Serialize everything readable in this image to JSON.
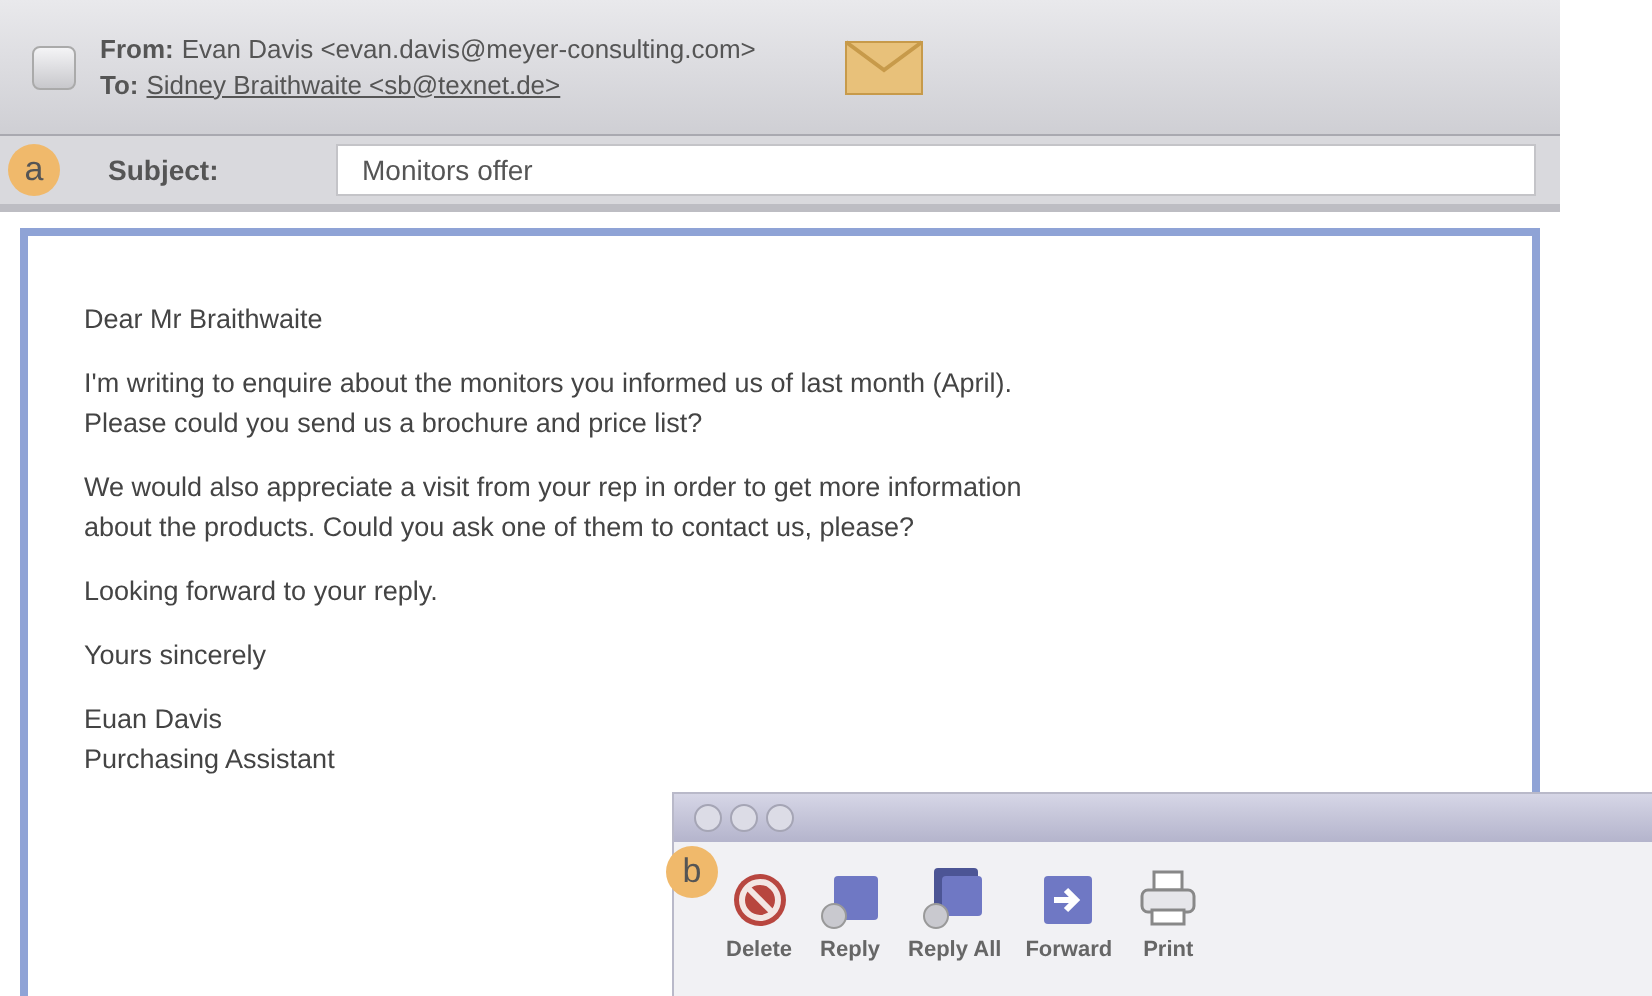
{
  "header": {
    "from_label": "From:",
    "from_value": "Evan Davis <evan.davis@meyer-consulting.com>",
    "to_label": "To:",
    "to_value": "Sidney Braithwaite <sb@texnet.de>"
  },
  "subject": {
    "callout": "a",
    "label": "Subject:",
    "value": "Monitors offer"
  },
  "body": [
    {
      "lines": [
        "Dear Mr Braithwaite"
      ]
    },
    {
      "lines": [
        "I'm writing to enquire about the monitors you informed us of last month (April).",
        "Please could you send us a brochure and price list?"
      ]
    },
    {
      "lines": [
        "We would also appreciate a visit from your rep in order to get more information",
        "about the products. Could you ask one of them to contact us, please?"
      ]
    },
    {
      "lines": [
        "Looking forward to your reply."
      ]
    },
    {
      "lines": [
        "Yours sincerely"
      ]
    },
    {
      "lines": [
        "Euan Davis",
        "Purchasing Assistant"
      ]
    }
  ],
  "toolbar": {
    "callout": "b",
    "buttons": [
      {
        "kind": "delete",
        "label": "Delete"
      },
      {
        "kind": "reply",
        "label": "Reply"
      },
      {
        "kind": "reply_all",
        "label": "Reply All"
      },
      {
        "kind": "forward",
        "label": "Forward"
      },
      {
        "kind": "print",
        "label": "Print"
      }
    ]
  }
}
